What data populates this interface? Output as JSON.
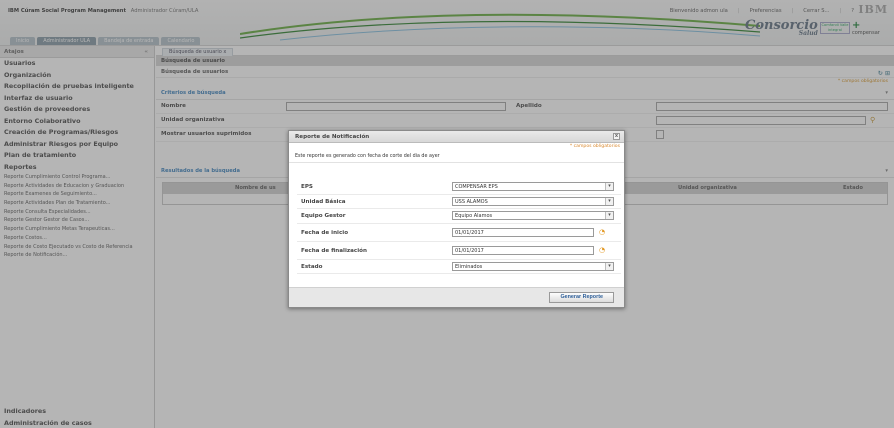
{
  "header": {
    "app_title": "IBM Cúram Social Program Management",
    "user_role": "Administrador Cúram/ULA",
    "welcome": "Bienvenido admon ula",
    "preferences": "Preferencias",
    "logout": "Cerrar S...",
    "help": "?",
    "ibm_logo": "IBM",
    "brand_name": "Consorcio",
    "brand_sub": "Salud",
    "brand2": "Comfandi Valle integral",
    "brand3": "compensar"
  },
  "tabs": [
    "Inicio",
    "Administrador ULA",
    "Bandeja de entrada",
    "Calendario"
  ],
  "sidebar": {
    "header": "Atajos",
    "items": [
      "Usuarios",
      "Organización",
      "Recopilación de pruebas inteligente",
      "Interfaz de usuario",
      "Gestión de proveedores",
      "Entorno Colaborativo",
      "Creación de Programas/Riesgos",
      "Administrar Riesgos por Equipo",
      "Plan de tratamiento",
      "Reportes"
    ],
    "subitems": [
      "Reporte Cumplimiento Control Programa...",
      "Reporte Actividades de Educacion y Graduacion",
      "Reporte Examenes de Seguimiento...",
      "Reporte Actividades Plan de Tratamiento...",
      "Reporte Consulta Especialidades...",
      "Reporte Gestor Gestor de Casos...",
      "Reporte Cumplimiento Metas Terapeuticas...",
      "Reporte Costos...",
      "Reporte de Costo Ejecutado vs Costo de Referencia",
      "Reporte de Notificación..."
    ],
    "bottom_items": [
      "Indicadores",
      "Administración de casos"
    ]
  },
  "main": {
    "tab_label": "Búsqueda de usuario",
    "bar_title": "Búsqueda de usuario",
    "subbar_title": "Búsqueda de usuarios",
    "required_note": "* campos obligatorios",
    "criteria_title": "Criterios de búsqueda",
    "field_nombre": "Nombre",
    "field_apellido": "Apellido",
    "field_unidad": "Unidad organizativa",
    "field_mostrar": "Mostrar usuarios suprimidos",
    "results_title": "Resultados de la búsqueda",
    "col_nombre": "Nombre de us",
    "col_unidad": "Unidad organizativa",
    "col_estado": "Estado"
  },
  "modal": {
    "title": "Reporte de Notificación",
    "close": "x",
    "required_note": "* campos obligatorios",
    "note": "Este reporte es generado con fecha de corte del dia de ayer",
    "fields": {
      "eps_label": "EPS",
      "eps_value": "COMPENSAR EPS",
      "unidad_label": "Unidad Básica",
      "unidad_value": "USS ALAMOS",
      "equipo_label": "Equipo Gestor",
      "equipo_value": "Equipo Alamos",
      "inicio_label": "Fecha de inicio",
      "inicio_value": "01/01/2017",
      "fin_label": "Fecha de finalización",
      "fin_value": "01/01/2017",
      "estado_label": "Estado",
      "estado_value": "Eliminados"
    },
    "submit": "Generar Reporte"
  },
  "icons": {
    "dropdown": "chevron-down-icon",
    "calendar": "calendar-icon",
    "close": "close-icon"
  }
}
